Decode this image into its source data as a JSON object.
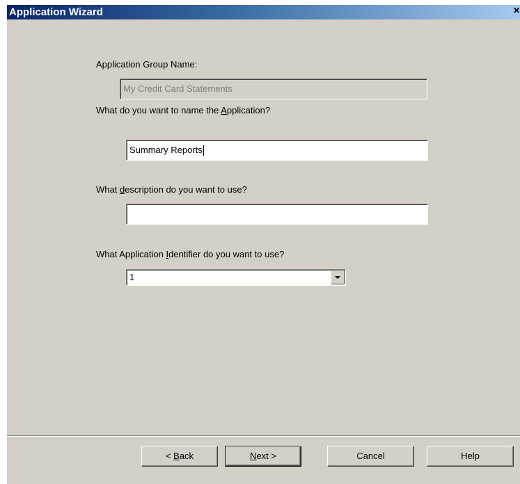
{
  "window": {
    "title": "Application Wizard",
    "close_glyph": "×"
  },
  "form": {
    "group_label": "Application Group Name:",
    "group_value": "My Credit Card Statements",
    "name_label_pre": "What do you want to name the ",
    "name_label_mnemonic": "A",
    "name_label_post": "pplication?",
    "name_value": "Summary Reports",
    "desc_label_pre": "What ",
    "desc_label_mnemonic": "d",
    "desc_label_post": "escription do you want to use?",
    "desc_value": "",
    "id_label_pre": "What Application ",
    "id_label_mnemonic": "I",
    "id_label_post": "dentifier do you want to use?",
    "id_value": "1"
  },
  "buttons": {
    "back_pre": "< ",
    "back_mnemonic": "B",
    "back_post": "ack",
    "next_mnemonic": "N",
    "next_post": "ext >",
    "cancel": "Cancel",
    "help": "Help"
  },
  "icons": {
    "close": "close-icon",
    "dropdown": "chevron-down-icon"
  },
  "colors": {
    "titlebar_start": "#0a246a",
    "titlebar_end": "#a6caf0",
    "window_bg": "#d4d0c8"
  }
}
